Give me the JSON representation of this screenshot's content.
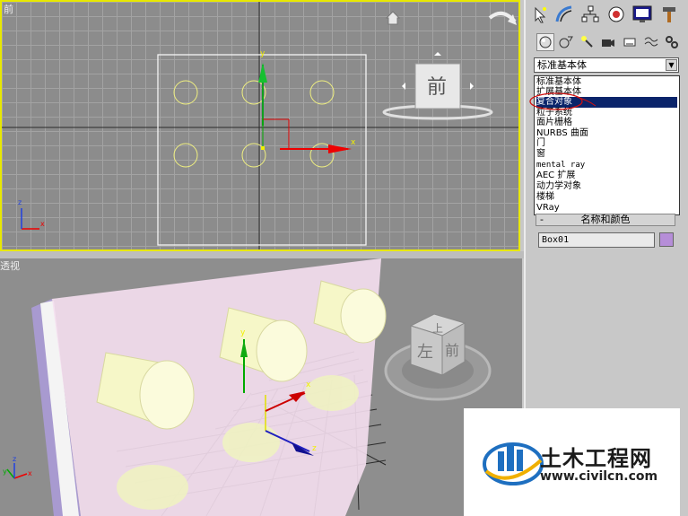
{
  "viewports": {
    "front": {
      "label": "前",
      "viewcube_label": "前",
      "axis_x": "x",
      "axis_y": "y",
      "axis_z": "z"
    },
    "perspective": {
      "label": "透视",
      "viewcube_front": "前",
      "viewcube_left": "左",
      "viewcube_top": "上",
      "axis_x": "x",
      "axis_y": "y",
      "axis_z": "z"
    }
  },
  "command_panel": {
    "tabs": [
      "create-tab",
      "modify-tab",
      "hierarchy-tab",
      "motion-tab",
      "display-tab",
      "utilities-tab"
    ],
    "sub_tabs": [
      "geometry",
      "shapes",
      "lights",
      "cameras",
      "helpers",
      "space-warps",
      "systems"
    ],
    "dropdown_value": "标准基本体",
    "dropdown_options": [
      "标准基本体",
      "扩展基本体",
      "复合对象",
      "粒子系统",
      "面片栅格",
      "NURBS 曲面",
      "门",
      "窗",
      "mental ray",
      "AEC 扩展",
      "动力学对象",
      "楼梯",
      "VRay"
    ],
    "selected_option": "复合对象",
    "rollout_toggle": "-",
    "rollout_title": "名称和颜色",
    "object_name": "Box01",
    "object_color": "#b68ed8"
  },
  "watermark": {
    "name": "土木工程网",
    "url": "www.civilcn.com"
  }
}
